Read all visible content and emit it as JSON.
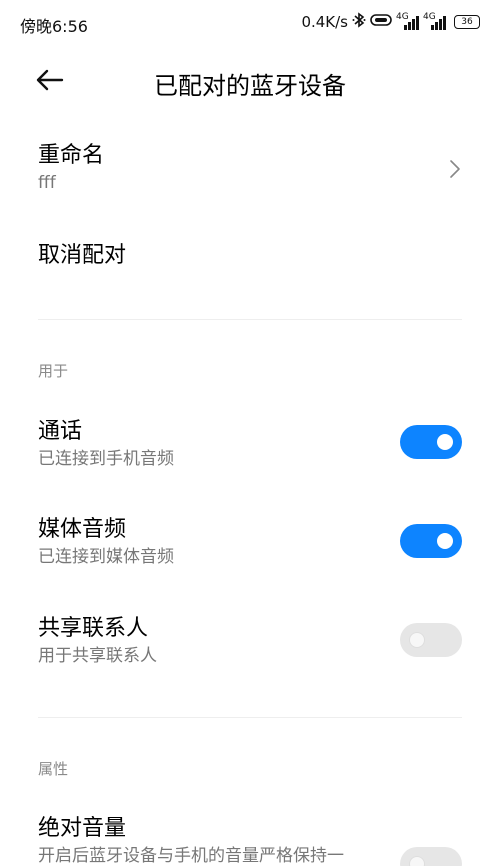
{
  "status_bar": {
    "time": "傍晚6:56",
    "network_speed": "0.4K/s",
    "signal_1_tag": "4G",
    "signal_2_tag": "4G",
    "battery": "36"
  },
  "header": {
    "title": "已配对的蓝牙设备"
  },
  "rename": {
    "title": "重命名",
    "value": "fff"
  },
  "unpair": {
    "title": "取消配对"
  },
  "section_use": {
    "label": "用于",
    "items": [
      {
        "title": "通话",
        "subtitle": "已连接到手机音频",
        "enabled": true
      },
      {
        "title": "媒体音频",
        "subtitle": "已连接到媒体音频",
        "enabled": true
      },
      {
        "title": "共享联系人",
        "subtitle": "用于共享联系人",
        "enabled": false
      }
    ]
  },
  "section_props": {
    "label": "属性",
    "items": [
      {
        "title": "绝对音量",
        "subtitle": "开启后蓝牙设备与手机的音量严格保持一",
        "enabled": false
      }
    ]
  },
  "colors": {
    "accent": "#0d84ff",
    "toggle_off": "#e6e6e6",
    "secondary_text": "#777777"
  }
}
